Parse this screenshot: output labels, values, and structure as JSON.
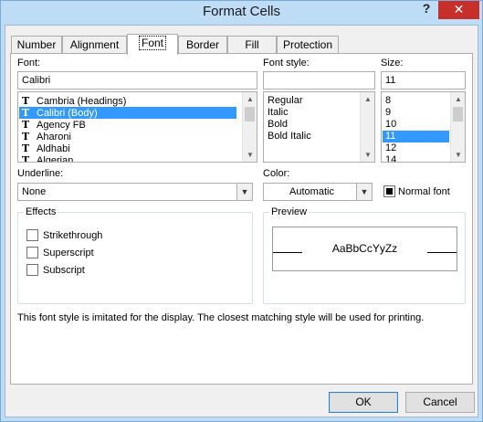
{
  "window": {
    "title": "Format Cells",
    "help_glyph": "?",
    "close_glyph": "✕"
  },
  "tabs": [
    {
      "label": "Number"
    },
    {
      "label": "Alignment"
    },
    {
      "label": "Font",
      "active": true
    },
    {
      "label": "Border"
    },
    {
      "label": "Fill"
    },
    {
      "label": "Protection"
    }
  ],
  "font": {
    "label": "Font:",
    "value": "Calibri",
    "items": [
      {
        "label": "Cambria (Headings)",
        "icon": "truetype-icon"
      },
      {
        "label": "Calibri (Body)",
        "icon": "truetype-icon",
        "selected": true
      },
      {
        "label": "Agency FB",
        "icon": "truetype-icon"
      },
      {
        "label": "Aharoni",
        "icon": "truetype-icon"
      },
      {
        "label": "Aldhabi",
        "icon": "truetype-icon"
      },
      {
        "label": "Algerian",
        "icon": "truetype-icon"
      }
    ],
    "icon_glyph": "T"
  },
  "font_style": {
    "label": "Font style:",
    "value": "",
    "items": [
      "Regular",
      "Italic",
      "Bold",
      "Bold Italic"
    ]
  },
  "size": {
    "label": "Size:",
    "value": "11",
    "items": [
      "8",
      "9",
      "10",
      "11",
      "12",
      "14"
    ],
    "selected": "11"
  },
  "underline": {
    "label": "Underline:",
    "value": "None"
  },
  "color": {
    "label": "Color:",
    "value": "Automatic",
    "swatch": "#000000"
  },
  "normal_font": {
    "label": "Normal font"
  },
  "effects": {
    "title": "Effects",
    "strikethrough": "Strikethrough",
    "superscript": "Superscript",
    "subscript": "Subscript"
  },
  "preview": {
    "title": "Preview",
    "sample": "AaBbCcYyZz"
  },
  "info_text": "This font style is imitated for the display.  The closest matching style will be used for printing.",
  "buttons": {
    "ok": "OK",
    "cancel": "Cancel"
  },
  "colors": {
    "accent": "#3399ff",
    "close": "#c7302a",
    "titlebar": "#bfdcf6"
  }
}
